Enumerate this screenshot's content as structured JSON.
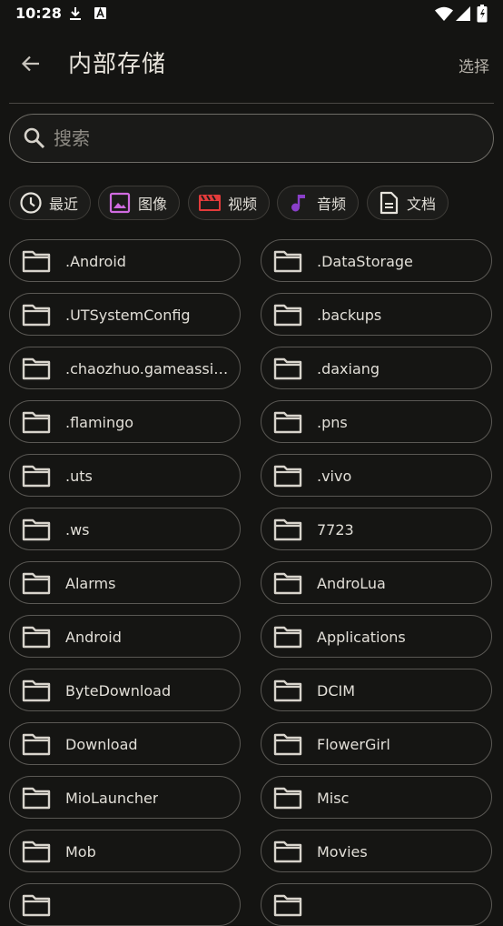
{
  "status_bar": {
    "time": "10:28"
  },
  "app_bar": {
    "title": "内部存储",
    "select_label": "选择"
  },
  "search": {
    "placeholder": "搜索"
  },
  "filters": [
    {
      "label": "最近",
      "icon": "clock-icon",
      "color": "#e6e3dc"
    },
    {
      "label": "图像",
      "icon": "image-icon",
      "color": "#d06be0"
    },
    {
      "label": "视频",
      "icon": "video-icon",
      "color": "#e23b3b"
    },
    {
      "label": "音频",
      "icon": "music-icon",
      "color": "#8a3fc9"
    },
    {
      "label": "文档",
      "icon": "document-icon",
      "color": "#e6e3dc"
    }
  ],
  "folders": [
    ".Android",
    ".DataStorage",
    ".UTSystemConfig",
    ".backups",
    ".chaozhuo.gameassist...",
    ".daxiang",
    ".flamingo",
    ".pns",
    ".uts",
    ".vivo",
    ".ws",
    "7723",
    "Alarms",
    "AndroLua",
    "Android",
    "Applications",
    "ByteDownload",
    "DCIM",
    "Download",
    "FlowerGirl",
    "MioLauncher",
    "Misc",
    "Mob",
    "Movies",
    "",
    ""
  ]
}
